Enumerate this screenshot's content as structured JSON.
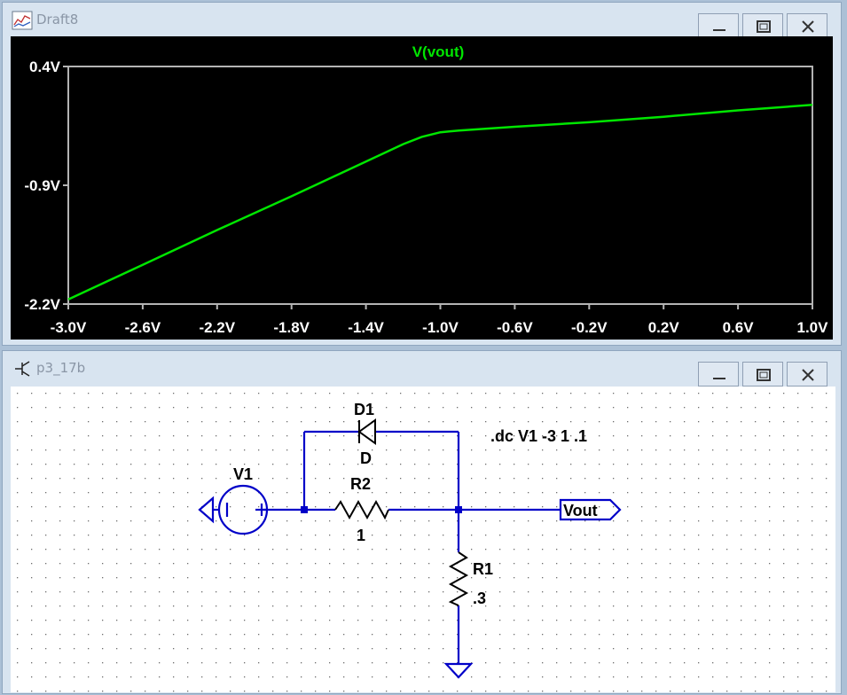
{
  "plot_window": {
    "title": "Draft8",
    "controls": [
      "minimize",
      "maximize",
      "close"
    ]
  },
  "schematic_window": {
    "title": "p3_17b",
    "controls": [
      "minimize",
      "maximize",
      "close"
    ],
    "components": {
      "d1": {
        "name": "D1",
        "value": "D"
      },
      "r2": {
        "name": "R2",
        "value": "1"
      },
      "r1": {
        "name": "R1",
        "value": ".3"
      },
      "v1": {
        "name": "V1"
      },
      "net_label": "Vout",
      "directive": ".dc V1 -3 1 .1"
    }
  },
  "colors": {
    "trace": "#00e600",
    "wire": "#0000c8",
    "plot_bg": "#000000",
    "axis": "#b4b4b4"
  },
  "chart_data": {
    "type": "line",
    "title": "V(vout)",
    "xlabel": "",
    "ylabel": "",
    "xlim": [
      -3.0,
      1.0
    ],
    "ylim": [
      -2.2,
      0.4
    ],
    "x_ticks": [
      "-3.0V",
      "-2.6V",
      "-2.2V",
      "-1.8V",
      "-1.4V",
      "-1.0V",
      "-0.6V",
      "-0.2V",
      "0.2V",
      "0.6V",
      "1.0V"
    ],
    "y_ticks": [
      "0.4V",
      "-0.9V",
      "-2.2V"
    ],
    "series": [
      {
        "name": "V(vout)",
        "x": [
          -3.0,
          -2.6,
          -2.2,
          -1.8,
          -1.4,
          -1.2,
          -1.1,
          -1.0,
          -0.9,
          -0.6,
          -0.2,
          0.2,
          0.6,
          1.0
        ],
        "y": [
          -2.15,
          -1.77,
          -1.39,
          -1.02,
          -0.64,
          -0.45,
          -0.37,
          -0.32,
          -0.3,
          -0.26,
          -0.21,
          -0.15,
          -0.08,
          -0.02
        ]
      }
    ]
  }
}
